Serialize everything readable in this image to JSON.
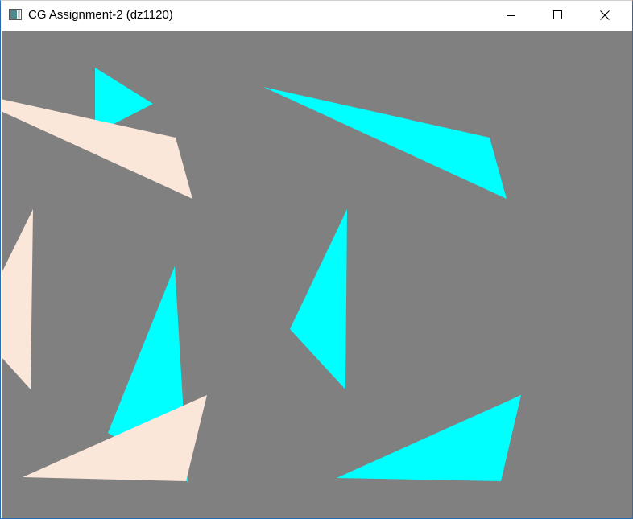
{
  "window": {
    "title": "CG Assignment-2 (dz1120)",
    "icons": {
      "app": "application-window-icon",
      "minimize": "minimize-icon",
      "maximize": "maximize-icon",
      "close": "close-icon"
    }
  },
  "canvas": {
    "background_color": "#808080",
    "shape_colors": {
      "cyan": "#00ffff",
      "peach": "#fbe6da"
    },
    "triangles": [
      {
        "name": "cyan-triangle-top-left-small",
        "color": "cyan"
      },
      {
        "name": "peach-triangle-top-left",
        "color": "peach"
      },
      {
        "name": "cyan-triangle-top-right",
        "color": "cyan"
      },
      {
        "name": "peach-triangle-left-edge",
        "color": "peach"
      },
      {
        "name": "cyan-triangle-center",
        "color": "cyan"
      },
      {
        "name": "cyan-triangle-bottom-left",
        "color": "cyan"
      },
      {
        "name": "peach-triangle-bottom-left",
        "color": "peach"
      },
      {
        "name": "cyan-triangle-bottom-right",
        "color": "cyan"
      }
    ]
  }
}
